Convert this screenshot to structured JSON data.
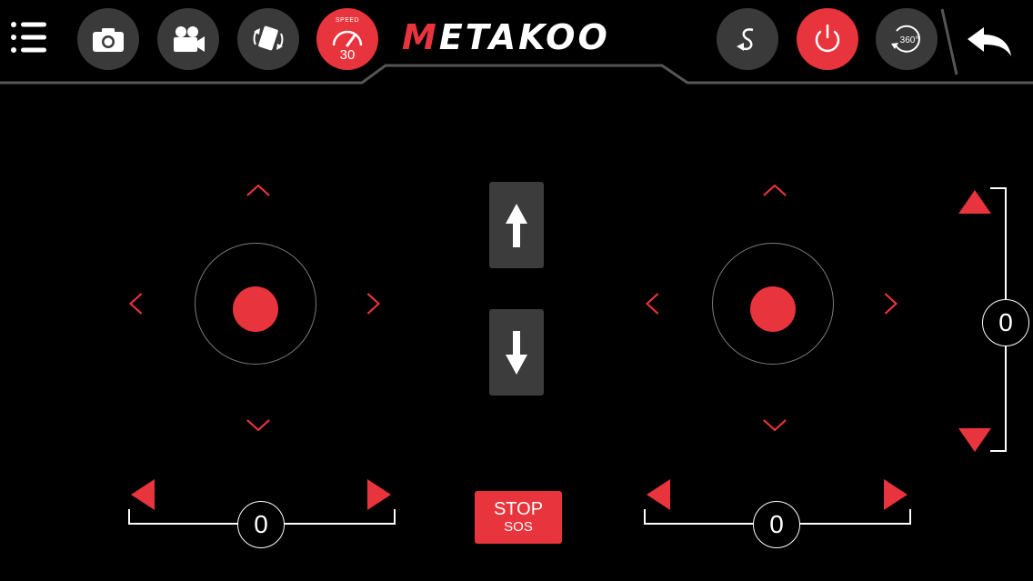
{
  "header": {
    "brand": {
      "first_letter": "M",
      "rest": "ETAKOO"
    },
    "speed": {
      "label": "SPEED",
      "value": "30"
    },
    "icons": {
      "menu": "menu-icon",
      "camera": "camera-icon",
      "video": "video-camera-icon",
      "phone_rotate": "phone-rotate-icon",
      "speed": "speedometer-icon",
      "flip": "flip-icon",
      "power": "power-icon",
      "rotate360": "rotate-360-icon",
      "back": "back-arrow-icon"
    },
    "rotate_label": "360°"
  },
  "controls": {
    "vertical_trim_value": "0",
    "left_trim_value": "0",
    "right_trim_value": "0",
    "stop": {
      "line1": "STOP",
      "line2": "SOS"
    }
  },
  "colors": {
    "accent": "#e8343c",
    "button_dark": "#3a3a3a",
    "background": "#000000"
  }
}
